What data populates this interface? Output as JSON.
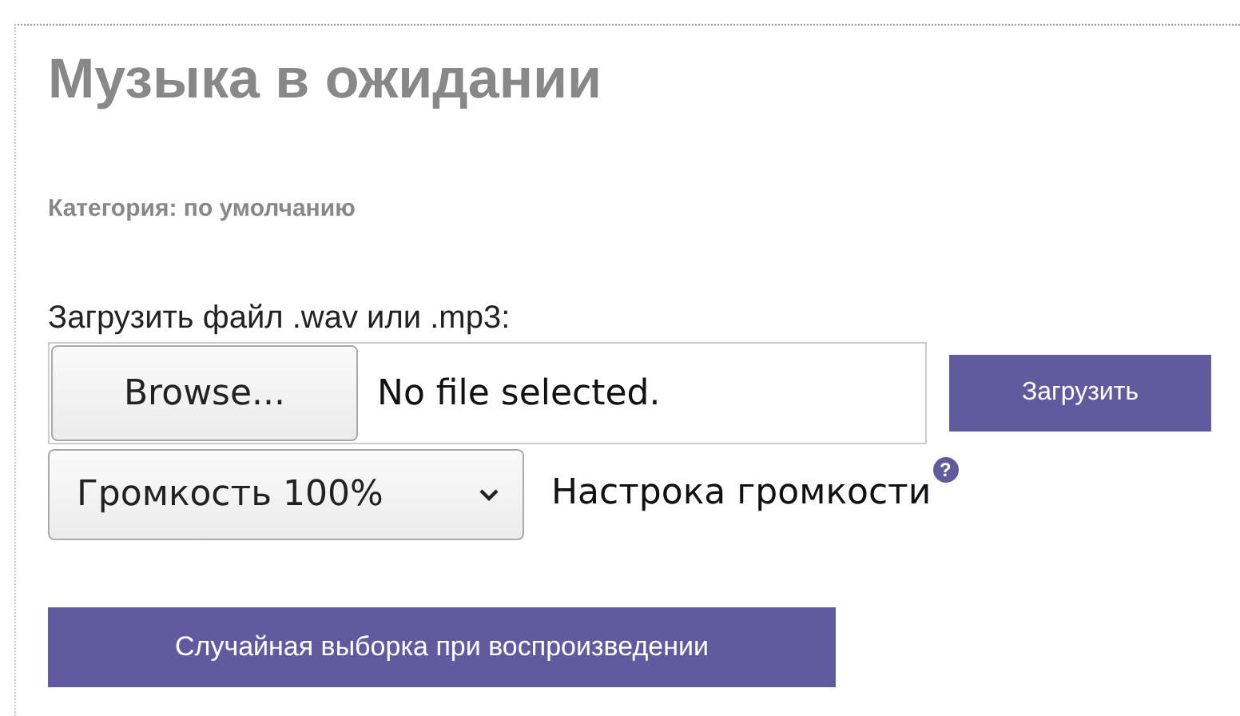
{
  "title": "Музыка в ожидании",
  "category": "Категория: по умолчанию",
  "upload": {
    "label": "Загрузить файл .wav или .mp3:",
    "browse": "Browse...",
    "file_status": "No file selected.",
    "button": "Загрузить"
  },
  "volume": {
    "value": "Громкость 100%",
    "label": "Настрока громкости",
    "help": "?"
  },
  "shuffle_button": "Случайная выборка при воспроизведении"
}
